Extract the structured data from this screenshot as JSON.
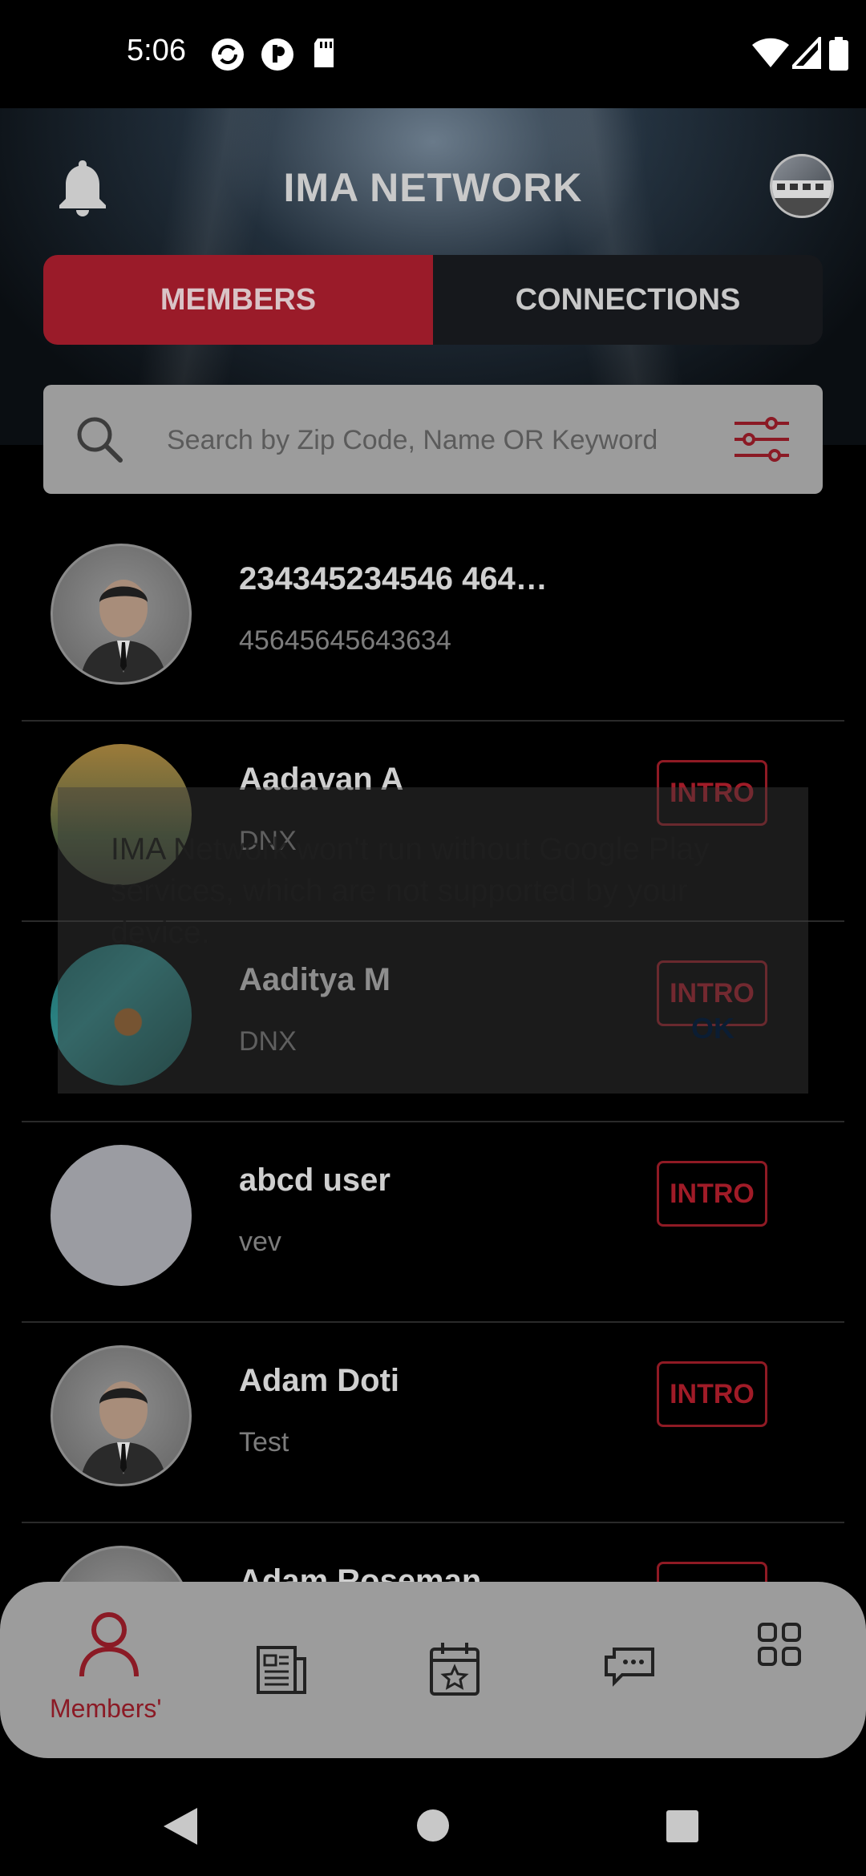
{
  "status_bar": {
    "time": "5:06"
  },
  "header": {
    "title": "IMA NETWORK"
  },
  "tabs": [
    {
      "label": "MEMBERS",
      "active": true
    },
    {
      "label": "CONNECTIONS",
      "active": false
    }
  ],
  "search": {
    "placeholder": "Search by Zip Code, Name OR Keyword"
  },
  "members": [
    {
      "name": "234345234546 464…",
      "subtitle": "45645645643634",
      "avatar": "default-person",
      "intro": ""
    },
    {
      "name": "Aadavan A",
      "subtitle": "DNX",
      "avatar": "mountain-photo",
      "intro": "INTRO"
    },
    {
      "name": "Aaditya M",
      "subtitle": "DNX",
      "avatar": "leaf-photo",
      "intro": "INTRO"
    },
    {
      "name": "abcd user",
      "subtitle": "vev",
      "avatar": "blank",
      "intro": "INTRO"
    },
    {
      "name": "Adam Doti",
      "subtitle": "Test",
      "avatar": "default-person",
      "intro": "INTRO"
    },
    {
      "name": "Adam Roseman",
      "subtitle": "",
      "avatar": "default-person",
      "intro": "INTRO"
    }
  ],
  "dialog": {
    "message": "IMA Network won't run without Google Play services, which are not supported by your device.",
    "ok_label": "OK"
  },
  "bottom_nav": {
    "items": [
      {
        "icon": "person-icon",
        "label": "Members'",
        "active": true
      },
      {
        "icon": "news-icon",
        "label": ""
      },
      {
        "icon": "calendar-star-icon",
        "label": ""
      },
      {
        "icon": "chat-icon",
        "label": ""
      },
      {
        "icon": "grid-icon",
        "label": ""
      }
    ]
  },
  "colors": {
    "accent": "#9a1b29",
    "background": "#000000",
    "nav_bg": "#9c9c9c"
  }
}
